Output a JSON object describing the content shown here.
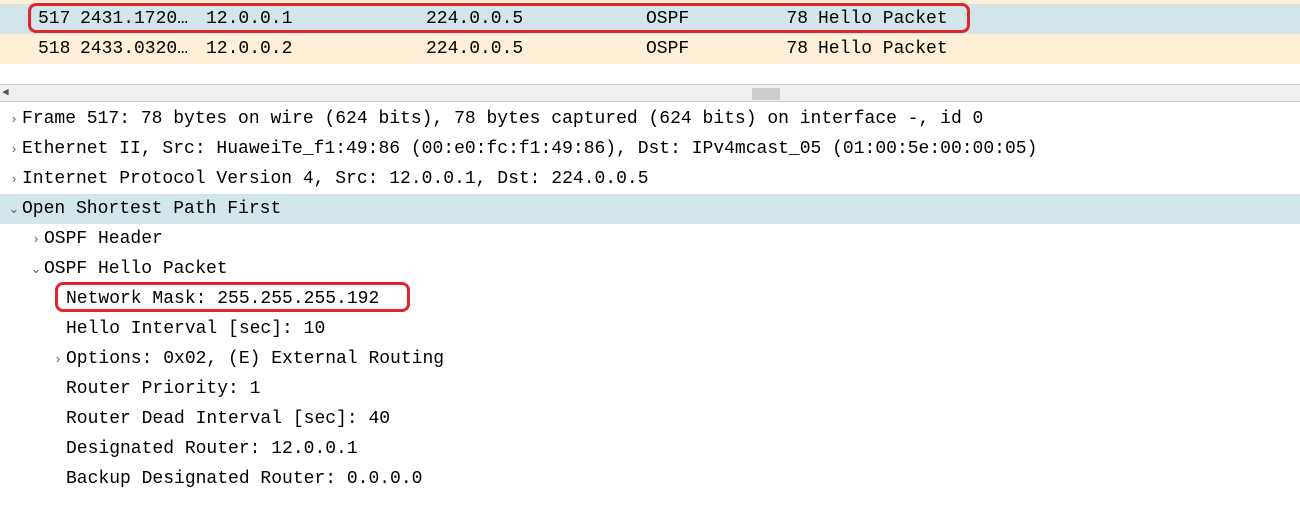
{
  "packet_list": {
    "rows": [
      {
        "no": "517",
        "time": "2431.1720…",
        "src": "12.0.0.1",
        "dst": "224.0.0.5",
        "proto": "OSPF",
        "len": "78",
        "info": "Hello Packet"
      },
      {
        "no": "518",
        "time": "2433.0320…",
        "src": "12.0.0.2",
        "dst": "224.0.0.5",
        "proto": "OSPF",
        "len": "78",
        "info": "Hello Packet"
      }
    ]
  },
  "details": {
    "frame": "Frame 517: 78 bytes on wire (624 bits), 78 bytes captured (624 bits) on interface -, id 0",
    "eth": "Ethernet II, Src: HuaweiTe_f1:49:86 (00:e0:fc:f1:49:86), Dst: IPv4mcast_05 (01:00:5e:00:00:05)",
    "ip": "Internet Protocol Version 4, Src: 12.0.0.1, Dst: 224.0.0.5",
    "ospf": "Open Shortest Path First",
    "ospf_header": "OSPF Header",
    "hello": "OSPF Hello Packet",
    "netmask": "Network Mask: 255.255.255.192",
    "hello_int": "Hello Interval [sec]: 10",
    "options": "Options: 0x02, (E) External Routing",
    "priority": "Router Priority: 1",
    "dead_int": "Router Dead Interval [sec]: 40",
    "dr": "Designated Router: 12.0.0.1",
    "bdr": "Backup Designated Router: 0.0.0.0"
  }
}
